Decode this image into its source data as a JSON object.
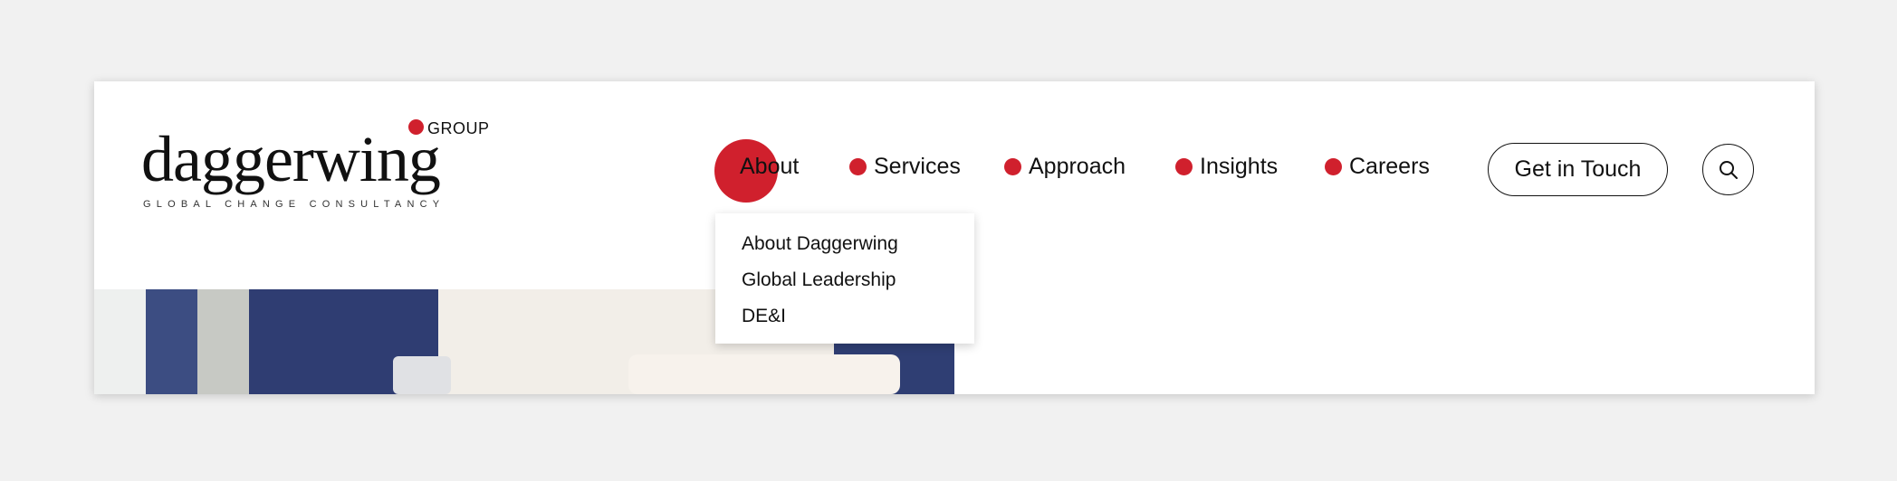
{
  "brand": {
    "name": "daggerwing",
    "suffix": "GROUP",
    "tagline": "GLOBAL CHANGE CONSULTANCY",
    "accent_color": "#d0202d"
  },
  "nav": {
    "items": [
      {
        "label": "About",
        "active": true
      },
      {
        "label": "Services"
      },
      {
        "label": "Approach"
      },
      {
        "label": "Insights"
      },
      {
        "label": "Careers"
      }
    ],
    "about_dropdown": [
      "About Daggerwing",
      "Global Leadership",
      "DE&I"
    ]
  },
  "actions": {
    "cta_label": "Get in Touch",
    "search_icon": "search-icon"
  }
}
